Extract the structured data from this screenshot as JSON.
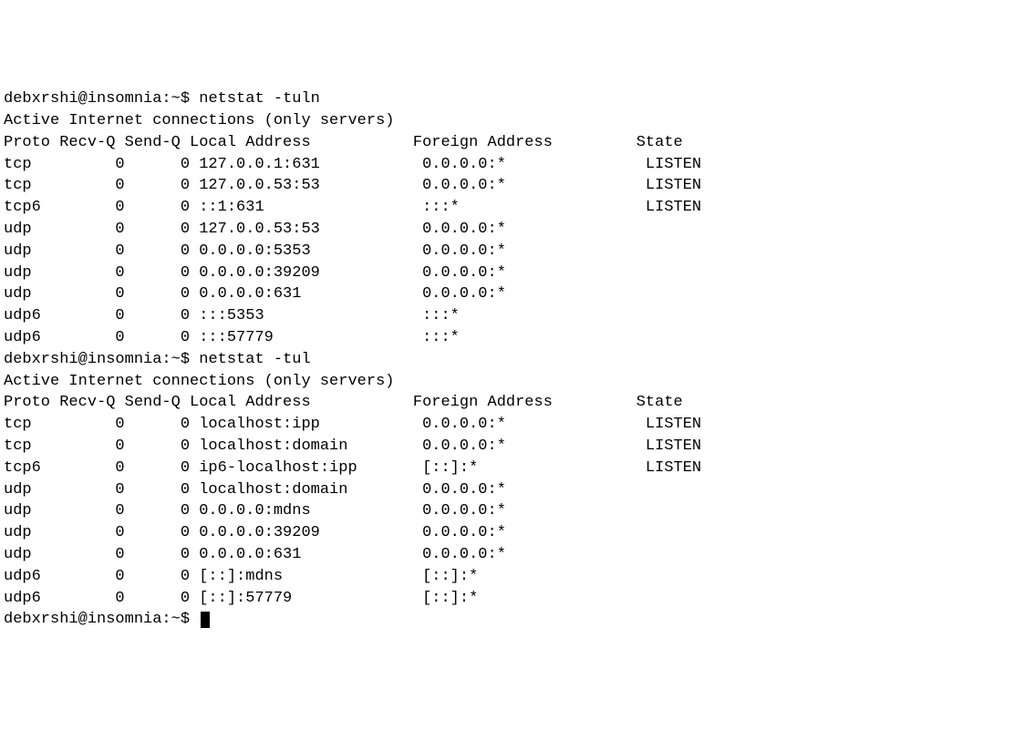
{
  "blocks": [
    {
      "prompt": "debxrshi@insomnia:~$ ",
      "command": "netstat -tuln",
      "header": "Active Internet connections (only servers)",
      "columns": "Proto Recv-Q Send-Q Local Address           Foreign Address         State",
      "rows": [
        {
          "proto": "tcp",
          "recvq": "0",
          "sendq": "0",
          "local": "127.0.0.1:631",
          "foreign": "0.0.0.0:*",
          "state": "LISTEN"
        },
        {
          "proto": "tcp",
          "recvq": "0",
          "sendq": "0",
          "local": "127.0.0.53:53",
          "foreign": "0.0.0.0:*",
          "state": "LISTEN"
        },
        {
          "proto": "tcp6",
          "recvq": "0",
          "sendq": "0",
          "local": "::1:631",
          "foreign": ":::*",
          "state": "LISTEN"
        },
        {
          "proto": "udp",
          "recvq": "0",
          "sendq": "0",
          "local": "127.0.0.53:53",
          "foreign": "0.0.0.0:*",
          "state": ""
        },
        {
          "proto": "udp",
          "recvq": "0",
          "sendq": "0",
          "local": "0.0.0.0:5353",
          "foreign": "0.0.0.0:*",
          "state": ""
        },
        {
          "proto": "udp",
          "recvq": "0",
          "sendq": "0",
          "local": "0.0.0.0:39209",
          "foreign": "0.0.0.0:*",
          "state": ""
        },
        {
          "proto": "udp",
          "recvq": "0",
          "sendq": "0",
          "local": "0.0.0.0:631",
          "foreign": "0.0.0.0:*",
          "state": ""
        },
        {
          "proto": "udp6",
          "recvq": "0",
          "sendq": "0",
          "local": ":::5353",
          "foreign": ":::*",
          "state": ""
        },
        {
          "proto": "udp6",
          "recvq": "0",
          "sendq": "0",
          "local": ":::57779",
          "foreign": ":::*",
          "state": ""
        }
      ]
    },
    {
      "prompt": "debxrshi@insomnia:~$ ",
      "command": "netstat -tul",
      "header": "Active Internet connections (only servers)",
      "columns": "Proto Recv-Q Send-Q Local Address           Foreign Address         State",
      "rows": [
        {
          "proto": "tcp",
          "recvq": "0",
          "sendq": "0",
          "local": "localhost:ipp",
          "foreign": "0.0.0.0:*",
          "state": "LISTEN"
        },
        {
          "proto": "tcp",
          "recvq": "0",
          "sendq": "0",
          "local": "localhost:domain",
          "foreign": "0.0.0.0:*",
          "state": "LISTEN"
        },
        {
          "proto": "tcp6",
          "recvq": "0",
          "sendq": "0",
          "local": "ip6-localhost:ipp",
          "foreign": "[::]:*",
          "state": "LISTEN"
        },
        {
          "proto": "udp",
          "recvq": "0",
          "sendq": "0",
          "local": "localhost:domain",
          "foreign": "0.0.0.0:*",
          "state": ""
        },
        {
          "proto": "udp",
          "recvq": "0",
          "sendq": "0",
          "local": "0.0.0.0:mdns",
          "foreign": "0.0.0.0:*",
          "state": ""
        },
        {
          "proto": "udp",
          "recvq": "0",
          "sendq": "0",
          "local": "0.0.0.0:39209",
          "foreign": "0.0.0.0:*",
          "state": ""
        },
        {
          "proto": "udp",
          "recvq": "0",
          "sendq": "0",
          "local": "0.0.0.0:631",
          "foreign": "0.0.0.0:*",
          "state": ""
        },
        {
          "proto": "udp6",
          "recvq": "0",
          "sendq": "0",
          "local": "[::]:mdns",
          "foreign": "[::]:*",
          "state": ""
        },
        {
          "proto": "udp6",
          "recvq": "0",
          "sendq": "0",
          "local": "[::]:57779",
          "foreign": "[::]:*",
          "state": ""
        }
      ]
    }
  ],
  "final_prompt": "debxrshi@insomnia:~$ "
}
